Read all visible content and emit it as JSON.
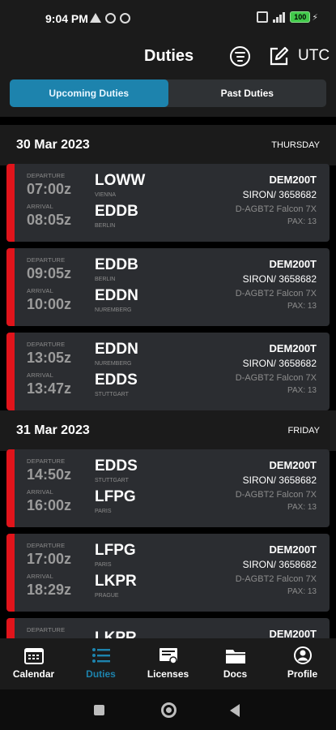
{
  "status_bar": {
    "time": "9:04 PM",
    "battery": "100"
  },
  "header": {
    "title": "Duties",
    "utc_label": "UTC",
    "tabs": [
      {
        "label": "Upcoming Duties",
        "active": true
      },
      {
        "label": "Past Duties",
        "active": false
      }
    ]
  },
  "groups": [
    {
      "date": "30 Mar 2023",
      "weekday": "THURSDAY",
      "duties": [
        {
          "dep_label": "DEPARTURE",
          "dep_time": "07:00z",
          "arr_label": "ARRIVAL",
          "arr_time": "08:05z",
          "from_code": "LOWW",
          "from_city": "VIENNA",
          "to_code": "EDDB",
          "to_city": "BERLIN",
          "reg": "DEM200T",
          "crew": "SIRON/ 3658682",
          "aircraft": "D-AGBT2 Falcon 7X",
          "pax": "PAX: 13"
        },
        {
          "dep_label": "DEPARTURE",
          "dep_time": "09:05z",
          "arr_label": "ARRIVAL",
          "arr_time": "10:00z",
          "from_code": "EDDB",
          "from_city": "BERLIN",
          "to_code": "EDDN",
          "to_city": "NUREMBERG",
          "reg": "DEM200T",
          "crew": "SIRON/ 3658682",
          "aircraft": "D-AGBT2 Falcon 7X",
          "pax": "PAX: 13"
        },
        {
          "dep_label": "DEPARTURE",
          "dep_time": "13:05z",
          "arr_label": "ARRIVAL",
          "arr_time": "13:47z",
          "from_code": "EDDN",
          "from_city": "NUREMBERG",
          "to_code": "EDDS",
          "to_city": "STUTTGART",
          "reg": "DEM200T",
          "crew": "SIRON/ 3658682",
          "aircraft": "D-AGBT2 Falcon 7X",
          "pax": "PAX: 13"
        }
      ]
    },
    {
      "date": "31 Mar 2023",
      "weekday": "FRIDAY",
      "duties": [
        {
          "dep_label": "DEPARTURE",
          "dep_time": "14:50z",
          "arr_label": "ARRIVAL",
          "arr_time": "16:00z",
          "from_code": "EDDS",
          "from_city": "STUTTGART",
          "to_code": "LFPG",
          "to_city": "PARIS",
          "reg": "DEM200T",
          "crew": "SIRON/ 3658682",
          "aircraft": "D-AGBT2 Falcon 7X",
          "pax": "PAX: 13"
        },
        {
          "dep_label": "DEPARTURE",
          "dep_time": "17:00z",
          "arr_label": "ARRIVAL",
          "arr_time": "18:29z",
          "from_code": "LFPG",
          "from_city": "PARIS",
          "to_code": "LKPR",
          "to_city": "PRAGUE",
          "reg": "DEM200T",
          "crew": "SIRON/ 3658682",
          "aircraft": "D-AGBT2 Falcon 7X",
          "pax": "PAX: 13"
        },
        {
          "dep_label": "DEPARTURE",
          "dep_time": "",
          "arr_label": "",
          "arr_time": "",
          "from_code": "LKPR",
          "from_city": "",
          "to_code": "",
          "to_city": "",
          "reg": "DEM200T",
          "crew": "",
          "aircraft": "",
          "pax": ""
        }
      ]
    }
  ],
  "bottom_nav": [
    {
      "label": "Calendar",
      "icon": "calendar-icon",
      "active": false
    },
    {
      "label": "Duties",
      "icon": "list-icon",
      "active": true
    },
    {
      "label": "Licenses",
      "icon": "license-icon",
      "active": false
    },
    {
      "label": "Docs",
      "icon": "folder-icon",
      "active": false
    },
    {
      "label": "Profile",
      "icon": "profile-icon",
      "active": false
    }
  ],
  "colors": {
    "accent": "#1d83ad",
    "alert": "#e0141b",
    "card": "#2b2d31",
    "surface": "#1b1b1b"
  }
}
